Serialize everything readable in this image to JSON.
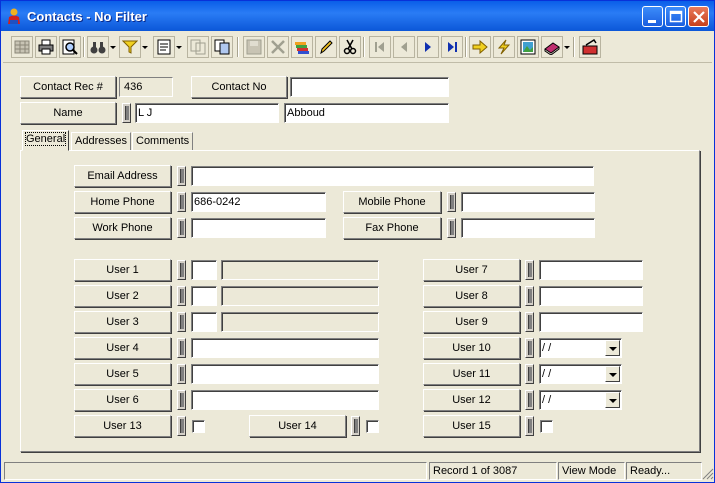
{
  "window": {
    "title": "Contacts - No Filter",
    "icon": "person-icon"
  },
  "header": {
    "contact_rec_label": "Contact Rec #",
    "contact_rec_value": "436",
    "contact_no_label": "Contact No",
    "contact_no_value": "",
    "name_label": "Name",
    "first_name": "L J",
    "last_name": "Abboud"
  },
  "tabs": [
    {
      "label": "General"
    },
    {
      "label": "Addresses"
    },
    {
      "label": "Comments"
    }
  ],
  "general": {
    "email_label": "Email Address",
    "email_value": "",
    "home_phone_label": "Home Phone",
    "home_phone_value": "686-0242",
    "mobile_phone_label": "Mobile Phone",
    "mobile_phone_value": "",
    "work_phone_label": "Work Phone",
    "work_phone_value": "",
    "fax_phone_label": "Fax Phone",
    "fax_phone_value": "",
    "user1": "User 1",
    "user2": "User 2",
    "user3": "User 3",
    "user4": "User 4",
    "user5": "User 5",
    "user6": "User 6",
    "user7": "User 7",
    "user8": "User 8",
    "user9": "User 9",
    "user10": "User 10",
    "user11": "User 11",
    "user12": "User 12",
    "user13": "User 13",
    "user14": "User 14",
    "user15": "User 15",
    "user10_value": " / /",
    "user11_value": " / /",
    "user12_value": " / /"
  },
  "status": {
    "record": "Record 1 of 3087",
    "mode": "View Mode",
    "state": "Ready..."
  }
}
